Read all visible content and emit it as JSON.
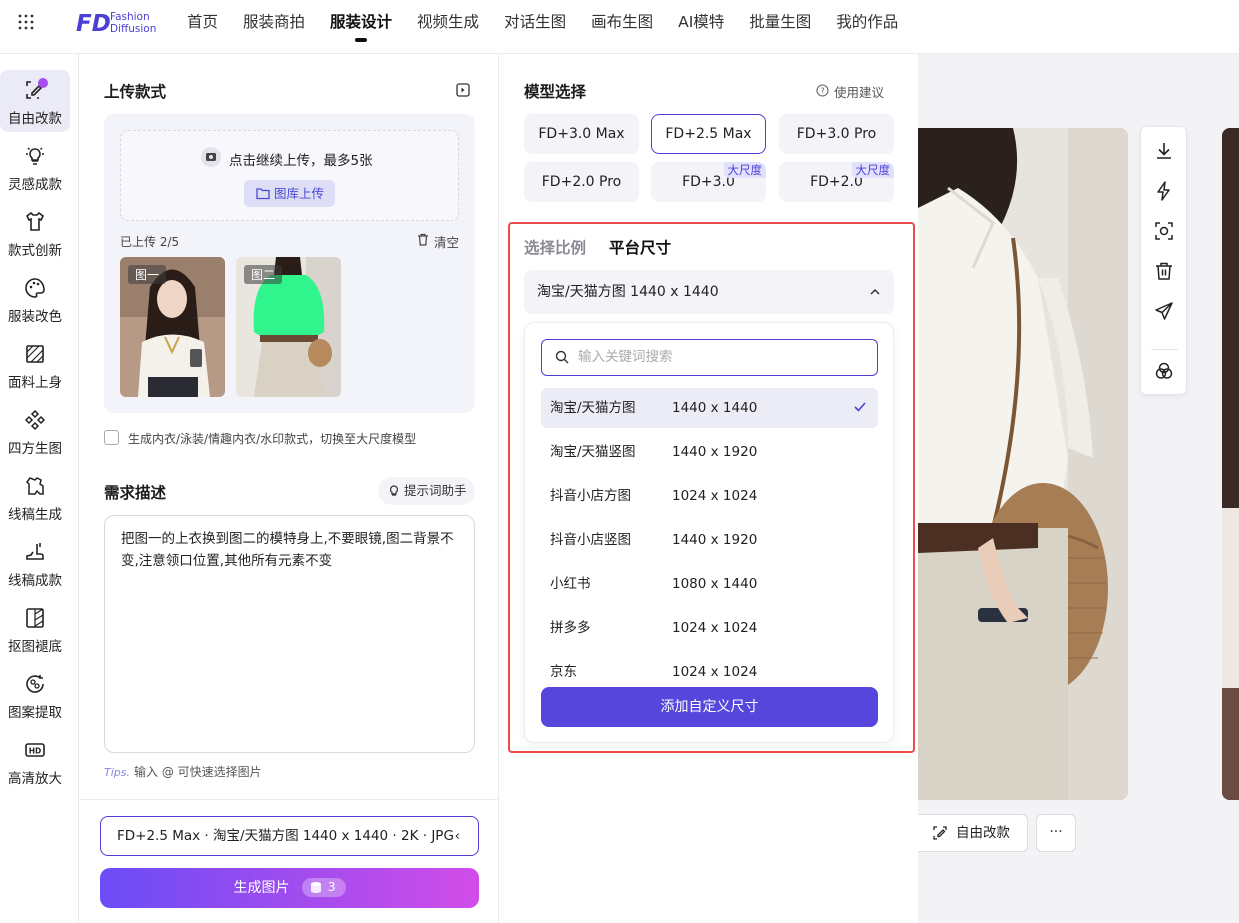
{
  "nav": {
    "items": [
      "首页",
      "服装商拍",
      "服装设计",
      "视频生成",
      "对话生图",
      "画布生图",
      "AI模特",
      "批量生图",
      "我的作品"
    ],
    "active_index": 2
  },
  "sidebar": {
    "items": [
      {
        "label": "自由改款",
        "icon": "edit-icon"
      },
      {
        "label": "灵感成款",
        "icon": "bulb-icon"
      },
      {
        "label": "款式创新",
        "icon": "shirt-icon"
      },
      {
        "label": "服装改色",
        "icon": "palette-icon"
      },
      {
        "label": "面料上身",
        "icon": "fabric-icon"
      },
      {
        "label": "四方生图",
        "icon": "diamond-grid-icon"
      },
      {
        "label": "线稿生成",
        "icon": "sketch-icon"
      },
      {
        "label": "线稿成款",
        "icon": "boot-icon"
      },
      {
        "label": "抠图褪底",
        "icon": "cutout-icon"
      },
      {
        "label": "图案提取",
        "icon": "pattern-icon"
      },
      {
        "label": "高清放大",
        "icon": "hd-icon"
      }
    ]
  },
  "upload": {
    "title": "上传款式",
    "prompt": "点击继续上传，最多5张",
    "gallery_button": "图库上传",
    "count": "已上传 2/5",
    "clear": "清空",
    "images": [
      {
        "tag": "图一"
      },
      {
        "tag": "图二"
      }
    ],
    "checkbox_label": "生成内衣/泳装/情趣内衣/水印款式，切换至大尺度模型"
  },
  "description": {
    "title": "需求描述",
    "helper": "提示词助手",
    "text": "把图一的上衣换到图二的模特身上,不要眼镜,图二背景不变,注意领口位置,其他所有元素不变",
    "tips_label": "Tips.",
    "tips_text": "输入 @ 可快速选择图片"
  },
  "footer": {
    "settings": "FD+2.5 Max · 淘宝/天猫方图 1440 x 1440 · 2K · JPG",
    "generate": "生成图片",
    "cost": "3"
  },
  "model": {
    "title": "模型选择",
    "advice": "使用建议",
    "options": [
      {
        "label": "FD+3.0 Max",
        "badge": ""
      },
      {
        "label": "FD+2.5 Max",
        "badge": ""
      },
      {
        "label": "FD+3.0 Pro",
        "badge": ""
      },
      {
        "label": "FD+2.0 Pro",
        "badge": ""
      },
      {
        "label": "FD+3.0",
        "badge": "大尺度"
      },
      {
        "label": "FD+2.0",
        "badge": "大尺度"
      }
    ],
    "selected_index": 1
  },
  "ratio": {
    "tab_ratio": "选择比例",
    "tab_platform": "平台尺寸",
    "selected": "淘宝/天猫方图 1440 x 1440",
    "search_placeholder": "输入关键词搜索",
    "options": [
      {
        "name": "淘宝/天猫方图",
        "size": "1440 x 1440"
      },
      {
        "name": "淘宝/天猫竖图",
        "size": "1440 x 1920"
      },
      {
        "name": "抖音小店方图",
        "size": "1024 x 1024"
      },
      {
        "name": "抖音小店竖图",
        "size": "1440 x 1920"
      },
      {
        "name": "小红书",
        "size": "1080 x 1440"
      },
      {
        "name": "拼多多",
        "size": "1024 x 1024"
      },
      {
        "name": "京东",
        "size": "1024 x 1024"
      }
    ],
    "selected_index": 0,
    "add_custom": "添加自定义尺寸"
  },
  "preview": {
    "edit_button": "自由改款",
    "more_button": "···"
  },
  "colors": {
    "accent": "#4b3fd6",
    "highlight": "#ec4c4c",
    "gradient_start": "#6b4cf6",
    "gradient_end": "#d24ce8"
  }
}
